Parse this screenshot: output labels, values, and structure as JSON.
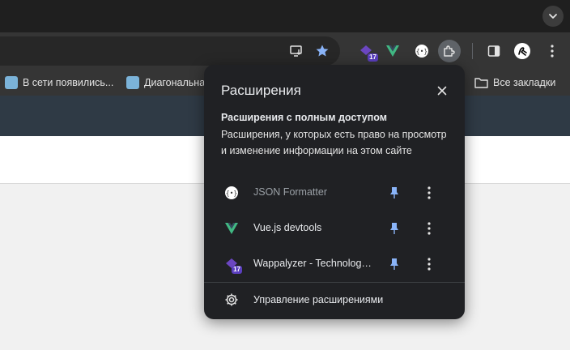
{
  "bookmarks": {
    "items": [
      {
        "label": "В сети появились..."
      },
      {
        "label": "Диагональна"
      }
    ],
    "all_label": "Все закладки"
  },
  "toolbar": {
    "wappalyzer_badge": "17"
  },
  "popup": {
    "title": "Расширения",
    "section_title": "Расширения с полным доступом",
    "section_desc": "Расширения, у которых есть право на просмотр и изменение информации на этом сайте",
    "extensions": [
      {
        "name": "JSON Formatter",
        "icon": "json-formatter-icon",
        "pinned": true
      },
      {
        "name": "Vue.js devtools",
        "icon": "vue-icon",
        "pinned": true
      },
      {
        "name": "Wappalyzer - Technology profiler",
        "icon": "wappalyzer-icon",
        "badge": "17",
        "pinned": true
      }
    ],
    "manage_label": "Управление расширениями"
  },
  "colors": {
    "accent": "#8ab4f8",
    "vue_green": "#41b883",
    "wappalyzer_purple": "#5b3fbf"
  }
}
